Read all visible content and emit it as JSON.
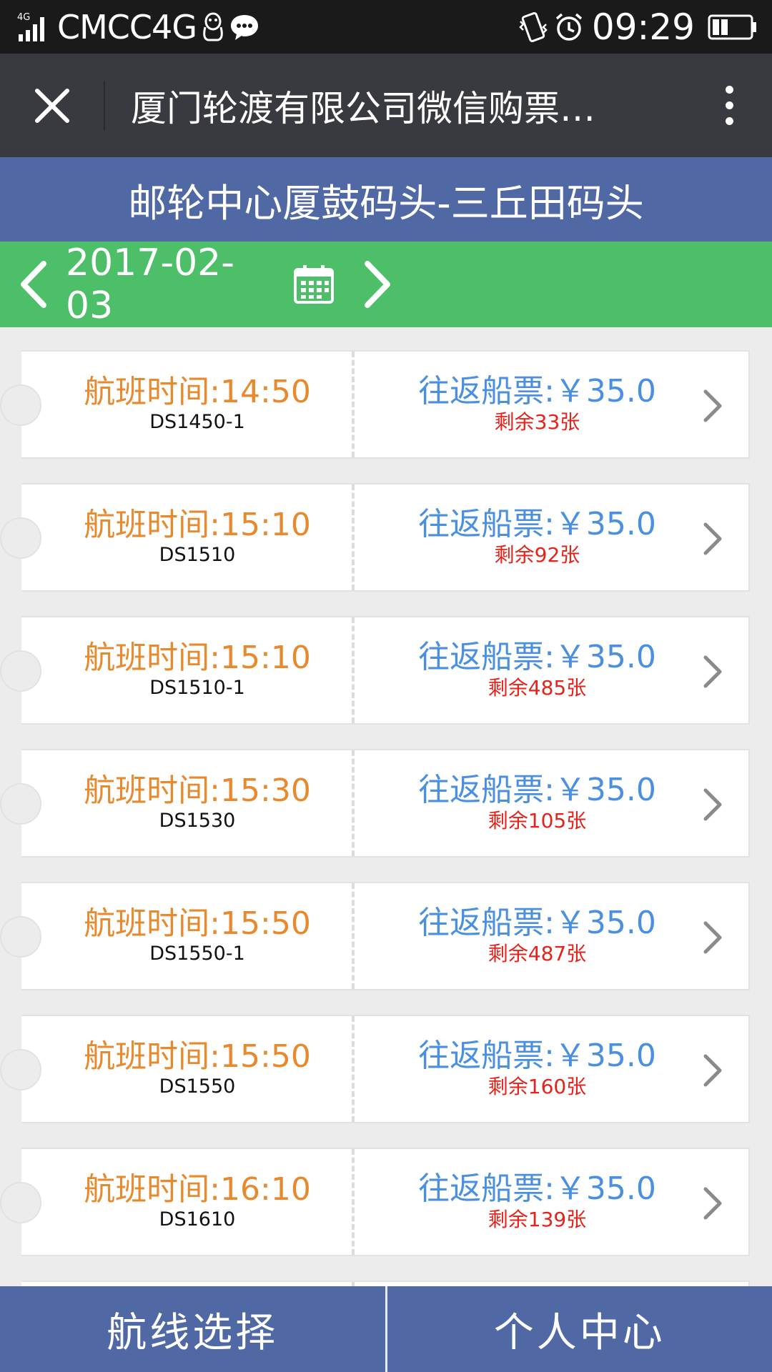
{
  "status_bar": {
    "network_badge": "4G",
    "carrier": "CMCC4G",
    "time": "09:29"
  },
  "title_bar": {
    "title": "厦门轮渡有限公司微信购票…"
  },
  "route": {
    "label": "邮轮中心厦鼓码头-三丘田码头"
  },
  "date_bar": {
    "date": "2017-02-03"
  },
  "tickets": [
    {
      "time": "航班时间:14:50",
      "code": "DS1450-1",
      "price": "往返船票:￥35.0",
      "remaining": "剩余33张"
    },
    {
      "time": "航班时间:15:10",
      "code": "DS1510",
      "price": "往返船票:￥35.0",
      "remaining": "剩余92张"
    },
    {
      "time": "航班时间:15:10",
      "code": "DS1510-1",
      "price": "往返船票:￥35.0",
      "remaining": "剩余485张"
    },
    {
      "time": "航班时间:15:30",
      "code": "DS1530",
      "price": "往返船票:￥35.0",
      "remaining": "剩余105张"
    },
    {
      "time": "航班时间:15:50",
      "code": "DS1550-1",
      "price": "往返船票:￥35.0",
      "remaining": "剩余487张"
    },
    {
      "time": "航班时间:15:50",
      "code": "DS1550",
      "price": "往返船票:￥35.0",
      "remaining": "剩余160张"
    },
    {
      "time": "航班时间:16:10",
      "code": "DS1610",
      "price": "往返船票:￥35.0",
      "remaining": "剩余139张"
    }
  ],
  "bottom_nav": {
    "route_select": "航线选择",
    "personal_center": "个人中心"
  },
  "colors": {
    "route_bar": "#5069a5",
    "date_bar": "#4cbf68",
    "time_text": "#e8892e",
    "price_text": "#4a8fe0",
    "remaining_text": "#e6221b"
  }
}
